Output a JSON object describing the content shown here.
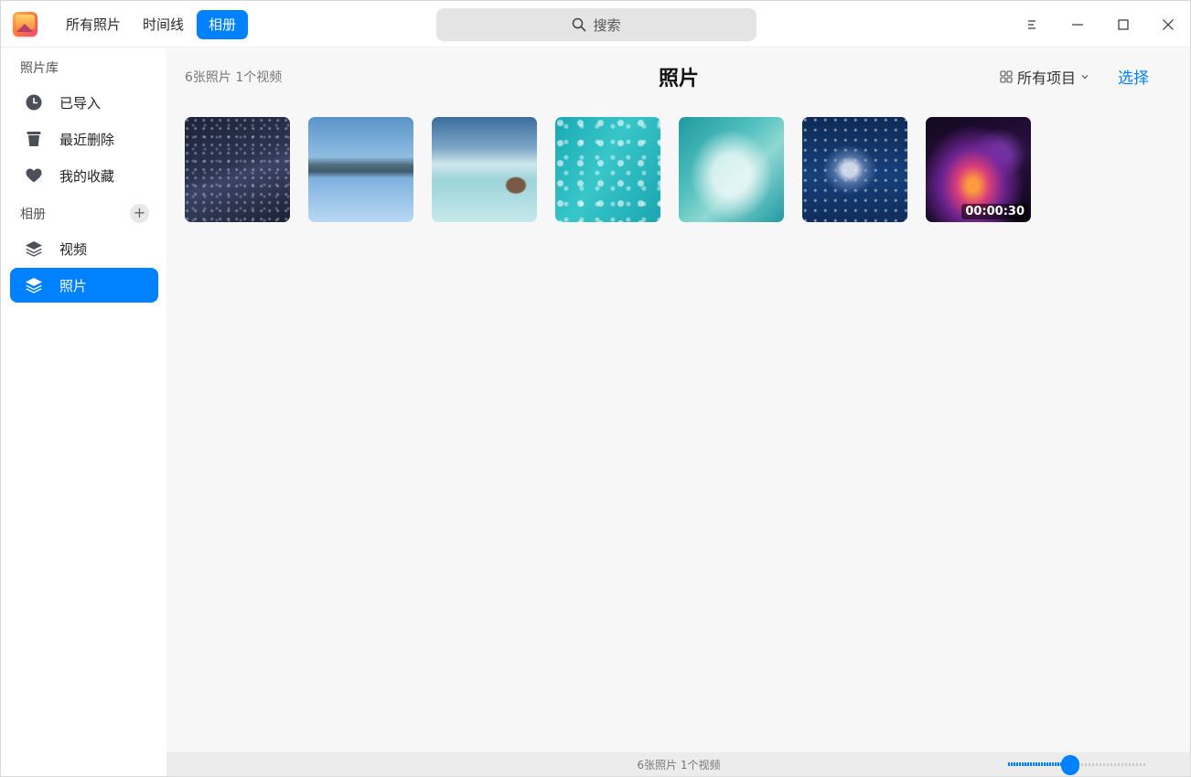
{
  "app": {
    "icon": "photos-app-icon"
  },
  "tabs": [
    {
      "label": "所有照片",
      "active": false
    },
    {
      "label": "时间线",
      "active": false
    },
    {
      "label": "相册",
      "active": true
    }
  ],
  "search": {
    "placeholder": "搜索",
    "icon": "search-icon"
  },
  "window_controls": [
    "menu-icon",
    "minimize-icon",
    "maximize-icon",
    "close-icon"
  ],
  "sidebar": {
    "library_title": "照片库",
    "library_items": [
      {
        "label": "已导入",
        "icon": "clock-icon"
      },
      {
        "label": "最近删除",
        "icon": "trash-icon"
      },
      {
        "label": "我的收藏",
        "icon": "heart-icon"
      }
    ],
    "albums_title": "相册",
    "album_items": [
      {
        "label": "视频",
        "icon": "layers-icon",
        "active": false
      },
      {
        "label": "照片",
        "icon": "layers-icon",
        "active": true
      }
    ]
  },
  "main": {
    "count": "6张照片 1个视频",
    "title": "照片",
    "filter_label": "所有项目",
    "select_label": "选择",
    "items": [
      {
        "type": "photo",
        "subject": "starry-night-sky"
      },
      {
        "type": "photo",
        "subject": "mountain-lake-reflection"
      },
      {
        "type": "photo",
        "subject": "tropical-beach-hut"
      },
      {
        "type": "photo",
        "subject": "turquoise-water-aerial"
      },
      {
        "type": "photo",
        "subject": "ocean-waves-aerial"
      },
      {
        "type": "photo",
        "subject": "blue-night-clouds"
      },
      {
        "type": "video",
        "subject": "purple-nebula",
        "duration": "00:00:30"
      }
    ]
  },
  "statusbar": {
    "text": "6张照片 1个视频",
    "zoom_level": 0.45
  },
  "colors": {
    "accent": "#0081ff"
  }
}
